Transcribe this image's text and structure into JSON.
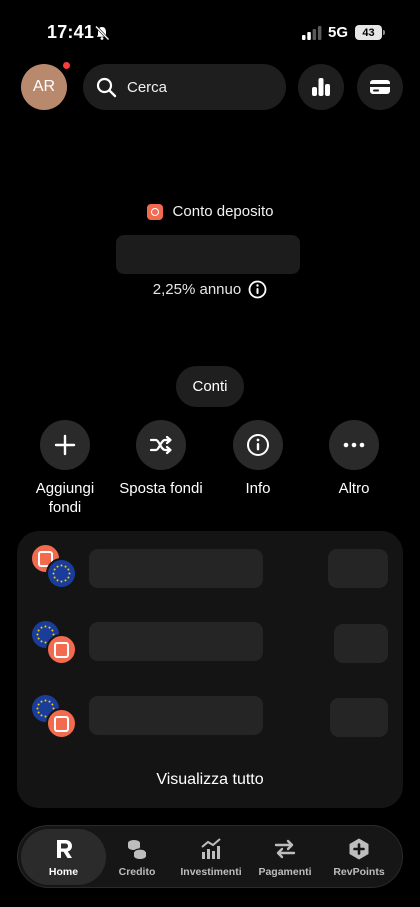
{
  "status_bar": {
    "time": "17:41",
    "network": "5G",
    "battery": "43"
  },
  "header": {
    "avatar_initials": "AR",
    "search_placeholder": "Cerca"
  },
  "account": {
    "name": "Conto deposito",
    "rate": "2,25% annuo"
  },
  "conti_label": "Conti",
  "actions": [
    {
      "label": "Aggiungi fondi",
      "icon": "plus-icon"
    },
    {
      "label": "Sposta fondi",
      "icon": "shuffle-icon"
    },
    {
      "label": "Info",
      "icon": "info-icon"
    },
    {
      "label": "Altro",
      "icon": "more-icon"
    }
  ],
  "accounts_card": {
    "view_all": "Visualizza tutto"
  },
  "tabbar": {
    "tabs": [
      {
        "label": "Home",
        "icon": "revolut-logo-icon",
        "active": true
      },
      {
        "label": "Credito",
        "icon": "coins-icon"
      },
      {
        "label": "Investimenti",
        "icon": "chart-icon"
      },
      {
        "label": "Pagamenti",
        "icon": "transfer-arrows-icon"
      },
      {
        "label": "RevPoints",
        "icon": "hexagon-plus-icon"
      }
    ]
  },
  "colors": {
    "background": "#000000",
    "accent_orange": "#f26b4f",
    "eu_blue": "#1a3d9c"
  }
}
